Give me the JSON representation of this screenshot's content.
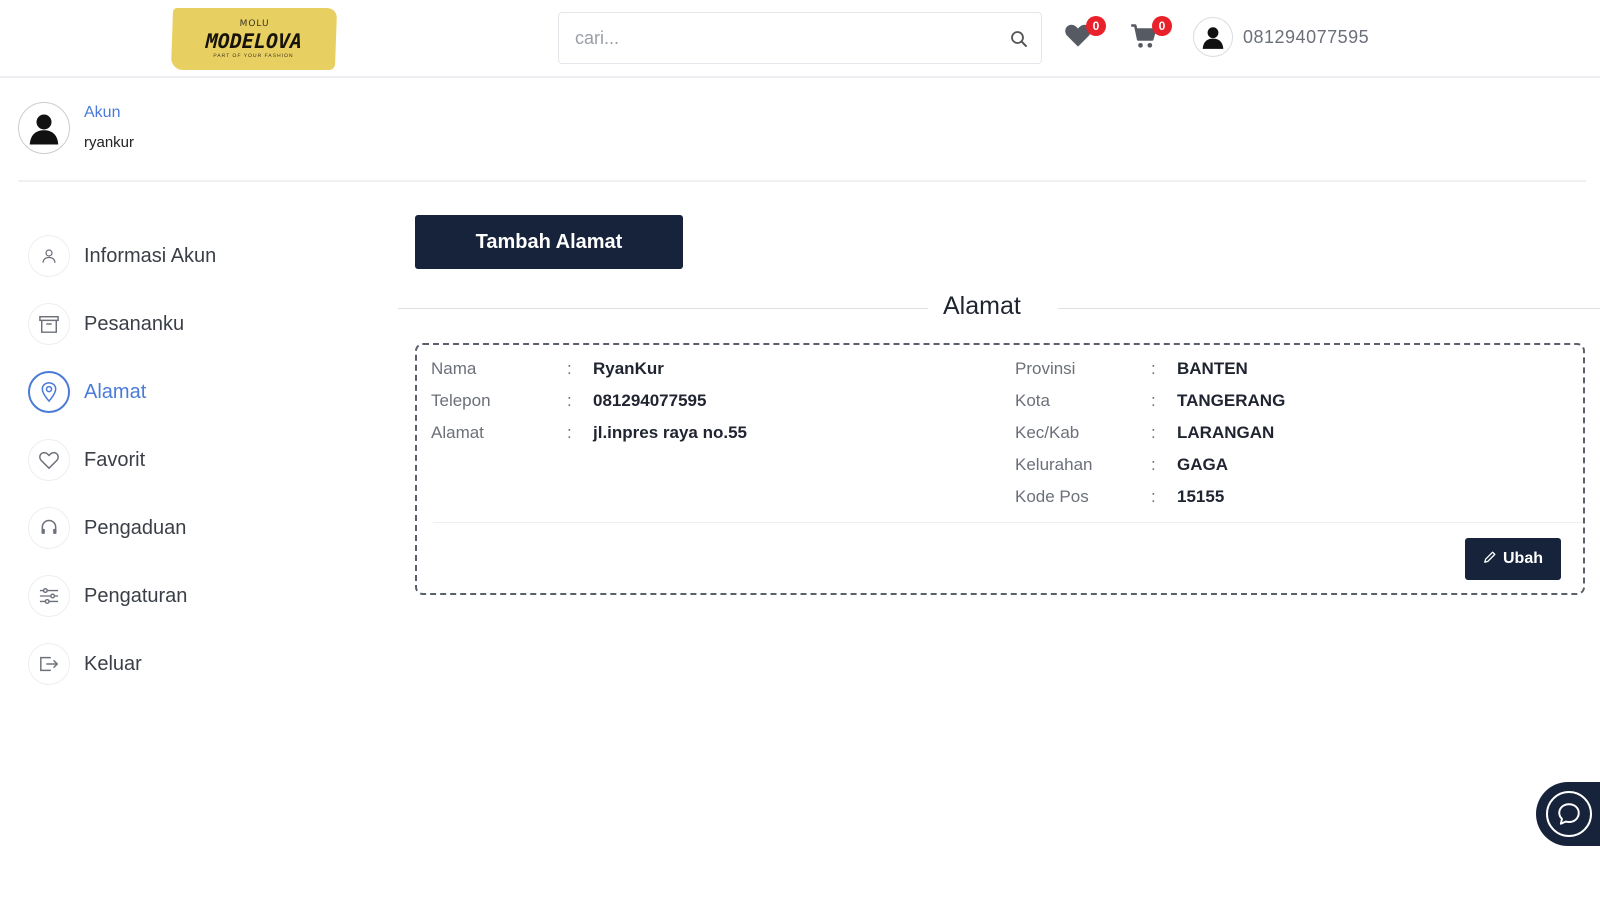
{
  "header": {
    "logo": {
      "top": "MOLU",
      "main": "MODELOVA",
      "sub": "PART OF YOUR FASHION"
    },
    "search": {
      "placeholder": "cari..."
    },
    "wishlist": {
      "icon": "heart-icon",
      "count": "0"
    },
    "cart": {
      "icon": "cart-icon",
      "count": "0"
    },
    "user": {
      "phone": "081294077595",
      "icon": "user-avatar-icon"
    }
  },
  "account": {
    "label": "Akun",
    "username": "ryankur"
  },
  "sidebar": {
    "items": [
      {
        "label": "Informasi Akun",
        "icon": "user-icon",
        "active": false
      },
      {
        "label": "Pesananku",
        "icon": "box-icon",
        "active": false
      },
      {
        "label": "Alamat",
        "icon": "map-pin-icon",
        "active": true
      },
      {
        "label": "Favorit",
        "icon": "heart-icon",
        "active": false
      },
      {
        "label": "Pengaduan",
        "icon": "headset-icon",
        "active": false
      },
      {
        "label": "Pengaturan",
        "icon": "sliders-icon",
        "active": false
      },
      {
        "label": "Keluar",
        "icon": "logout-icon",
        "active": false
      }
    ]
  },
  "main": {
    "add_button": "Tambah Alamat",
    "section_title": "Alamat",
    "address": {
      "left": [
        {
          "key": "Nama",
          "sep": ":",
          "value": "RyanKur"
        },
        {
          "key": "Telepon",
          "sep": ":",
          "value": "081294077595"
        },
        {
          "key": "Alamat",
          "sep": ":",
          "value": "jl.inpres raya no.55"
        }
      ],
      "right": [
        {
          "key": "Provinsi",
          "sep": ":",
          "value": "BANTEN"
        },
        {
          "key": "Kota",
          "sep": ":",
          "value": "TANGERANG"
        },
        {
          "key": "Kec/Kab",
          "sep": ":",
          "value": "LARANGAN"
        },
        {
          "key": "Kelurahan",
          "sep": ":",
          "value": "GAGA"
        },
        {
          "key": "Kode Pos",
          "sep": ":",
          "value": "15155"
        }
      ],
      "edit_button": "Ubah"
    }
  },
  "colors": {
    "primary_dark": "#16233a",
    "accent_blue": "#4a7bd8",
    "badge_red": "#e8212b",
    "logo_yellow": "#e8cf62"
  }
}
